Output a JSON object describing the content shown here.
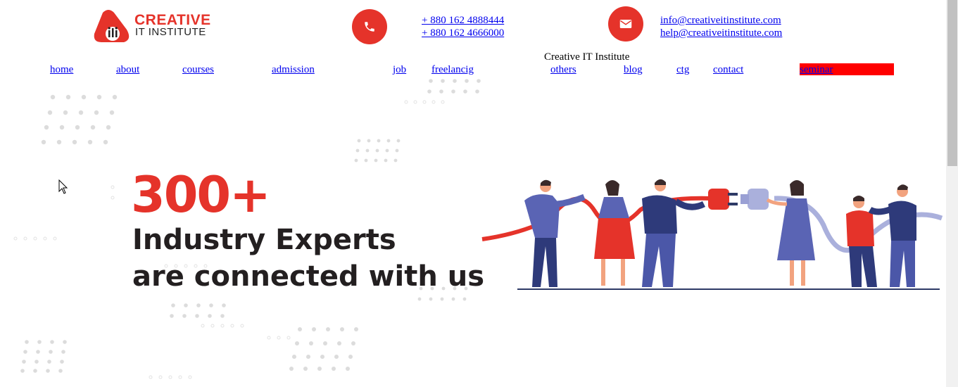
{
  "logo": {
    "line1": "CREATIVE",
    "line2": "IT INSTITUTE",
    "emblem": "iti"
  },
  "contact": {
    "phone_icon": "phone-icon",
    "phones": [
      "+ 880 162 4888444",
      "+ 880 162 4666000"
    ],
    "mail_icon": "envelope-icon",
    "emails": [
      "info@creativeitinstitute.com",
      "help@creativeitinstitute.com"
    ]
  },
  "site_title": "Creative IT Institute",
  "nav": {
    "home": "home",
    "about": "about",
    "courses": "courses",
    "admission": "admission",
    "job": "job",
    "freelancig": "freelancig",
    "others": "others",
    "blog": "blog",
    "ctg": "ctg",
    "contact": "contact",
    "seminar": "seminar"
  },
  "hero": {
    "number": "300+",
    "line1": "Industry Experts",
    "line2": "are connected with us"
  },
  "colors": {
    "brand_red": "#e5332a",
    "link": "#0000ee",
    "seminar_bg": "#ff0000",
    "navy": "#2e3a7a"
  }
}
